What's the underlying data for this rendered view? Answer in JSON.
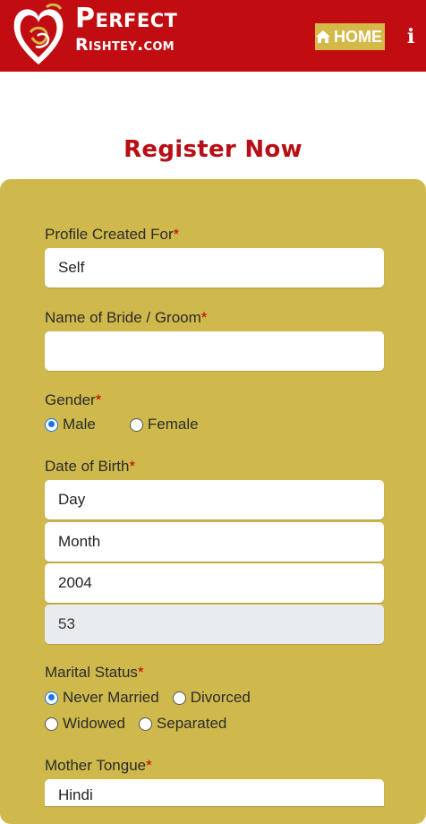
{
  "header": {
    "brand_line1": "Perfect",
    "brand_line2": "Rishtey.com",
    "home_label": "HOME",
    "info_label": "i",
    "colors": {
      "bar": "#c10d12",
      "home_button": "#d4b848"
    }
  },
  "title": "Register Now",
  "form": {
    "required_mark": "*",
    "profile_created_for": {
      "label": "Profile Created For",
      "value": "Self"
    },
    "name": {
      "label": "Name of Bride / Groom",
      "value": ""
    },
    "gender": {
      "label": "Gender",
      "options": [
        {
          "label": "Male",
          "checked": true
        },
        {
          "label": "Female",
          "checked": false
        }
      ]
    },
    "dob": {
      "label": "Date of Birth",
      "day": "Day",
      "month": "Month",
      "year": "2004",
      "age": "53"
    },
    "marital_status": {
      "label": "Marital Status",
      "options": [
        {
          "label": "Never Married",
          "checked": true
        },
        {
          "label": "Divorced",
          "checked": false
        },
        {
          "label": "Widowed",
          "checked": false
        },
        {
          "label": "Separated",
          "checked": false
        }
      ]
    },
    "mother_tongue": {
      "label": "Mother Tongue",
      "value": "Hindi"
    }
  },
  "colors": {
    "panel": "#cfb94c",
    "title": "#b80f16",
    "radio_checked": "#1a73e8"
  }
}
